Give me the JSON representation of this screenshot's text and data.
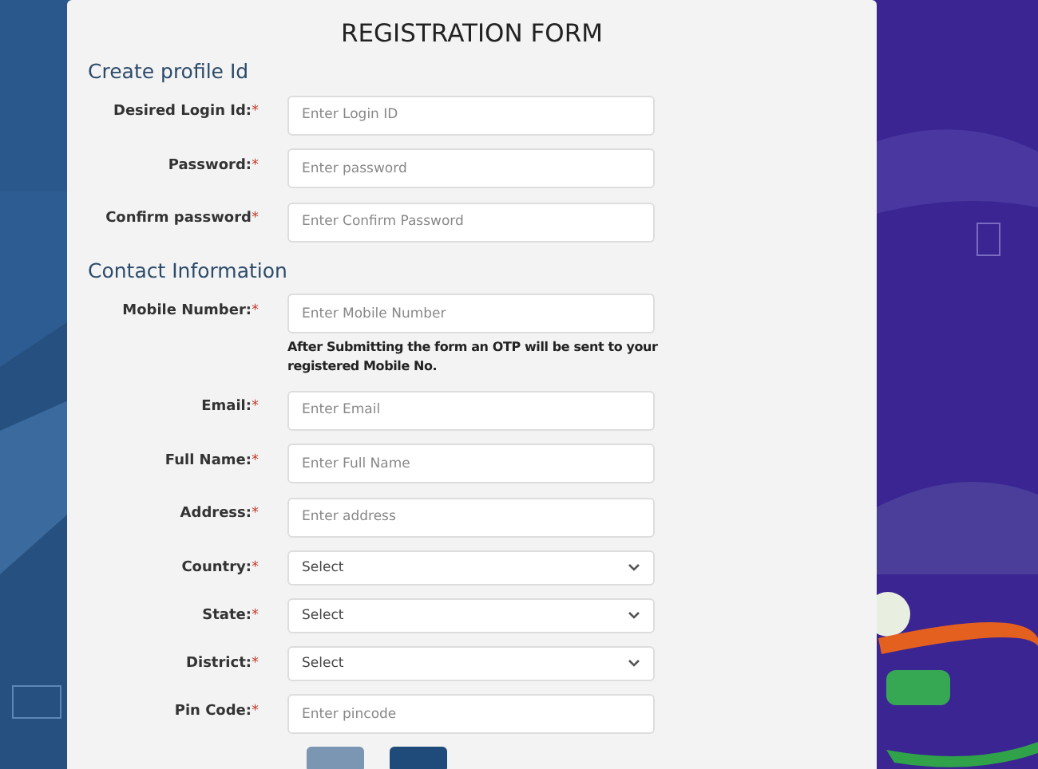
{
  "form": {
    "title": "REGISTRATION FORM",
    "sections": [
      {
        "heading": "Create profile Id",
        "rows": [
          {
            "label": "Desired Login Id:",
            "mark": "*",
            "kind": "input",
            "placeholder": "Enter Login ID"
          },
          {
            "label": "Password:",
            "mark": "*",
            "kind": "input",
            "placeholder": "Enter password"
          },
          {
            "label": "Confirm password",
            "mark": "*",
            "kind": "input",
            "placeholder": "Enter Confirm Password"
          }
        ]
      },
      {
        "heading": "Contact Information",
        "rows": [
          {
            "label": "Mobile Number:",
            "mark": "*",
            "kind": "input",
            "placeholder": "Enter Mobile Number",
            "note": "After Submitting the form an OTP will be sent to your registered Mobile No."
          },
          {
            "label": "Email:",
            "mark": "*",
            "kind": "input",
            "placeholder": "Enter Email"
          },
          {
            "label": "Full Name:",
            "mark": "*",
            "kind": "input",
            "placeholder": "Enter Full Name"
          },
          {
            "label": "Address:",
            "mark": "*",
            "kind": "input",
            "placeholder": "Enter address"
          },
          {
            "label": "Country:",
            "mark": "*",
            "kind": "select",
            "value": "Select"
          },
          {
            "label": "State:",
            "mark": "*",
            "kind": "select",
            "value": "Select"
          },
          {
            "label": "District:",
            "mark": "*",
            "kind": "select",
            "value": "Select"
          },
          {
            "label": "Pin Code:",
            "mark": "*",
            "kind": "input",
            "placeholder": "Enter pincode"
          }
        ]
      }
    ],
    "buttons": [
      {
        "kind": "secondary"
      },
      {
        "kind": "primary"
      }
    ]
  }
}
